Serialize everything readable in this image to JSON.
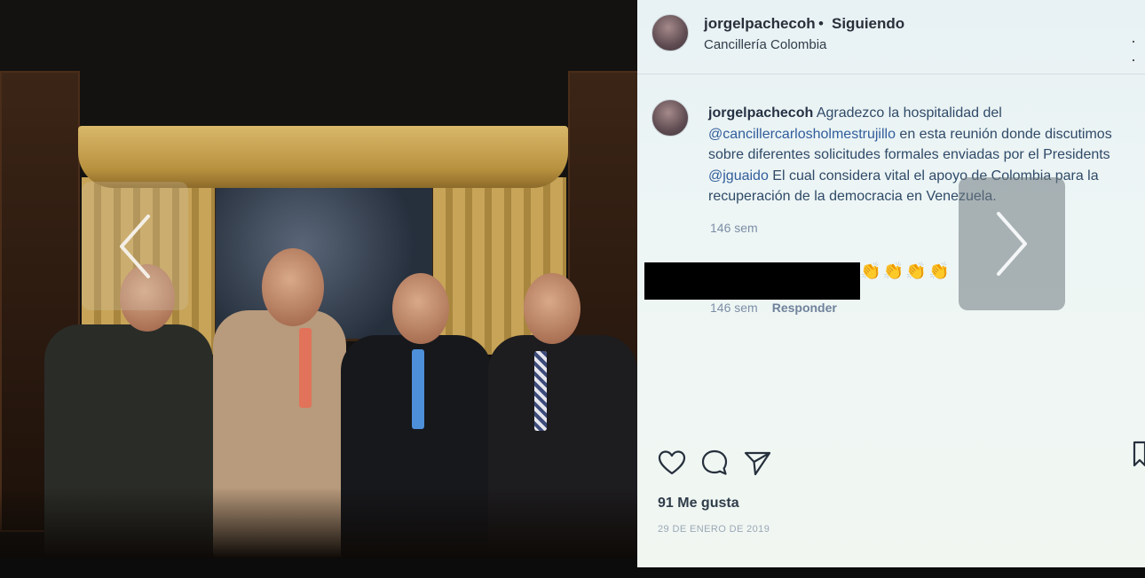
{
  "post": {
    "username": "jorgelpachecoh",
    "separator": "•",
    "follow_status": "Siguiendo",
    "location": "Cancillería Colombia",
    "more_icon": "more-options-icon",
    "caption": {
      "user": "jorgelpachecoh",
      "text_1": " Agradezco la hospitalidad del ",
      "mention_1": "@cancillercarlosholmestrujillo",
      "text_2": " en esta reunión donde discutimos sobre diferentes solicitudes formales enviadas por el Presidents ",
      "mention_2": "@jguaido",
      "text_3": " El cual considera vital el apoyo de Colombia para la recuperación de la democracia en Venezuela.",
      "time": "146 sem"
    },
    "comment": {
      "user_redacted": true,
      "emojis": [
        "👏",
        "👏",
        "👏",
        "👏"
      ],
      "time": "146 sem",
      "reply_label": "Responder"
    },
    "likes": "91 Me gusta",
    "date": "29 DE ENERO DE 2019",
    "icons": {
      "like": "heart-icon",
      "comment": "comment-bubble-icon",
      "share": "paper-plane-icon",
      "save": "bookmark-icon",
      "prev": "chevron-left-icon",
      "next": "chevron-right-icon"
    }
  },
  "colors": {
    "mention": "#315d9c",
    "panel_bg": "#eef6f5",
    "meta_text": "#7c8ea6"
  }
}
